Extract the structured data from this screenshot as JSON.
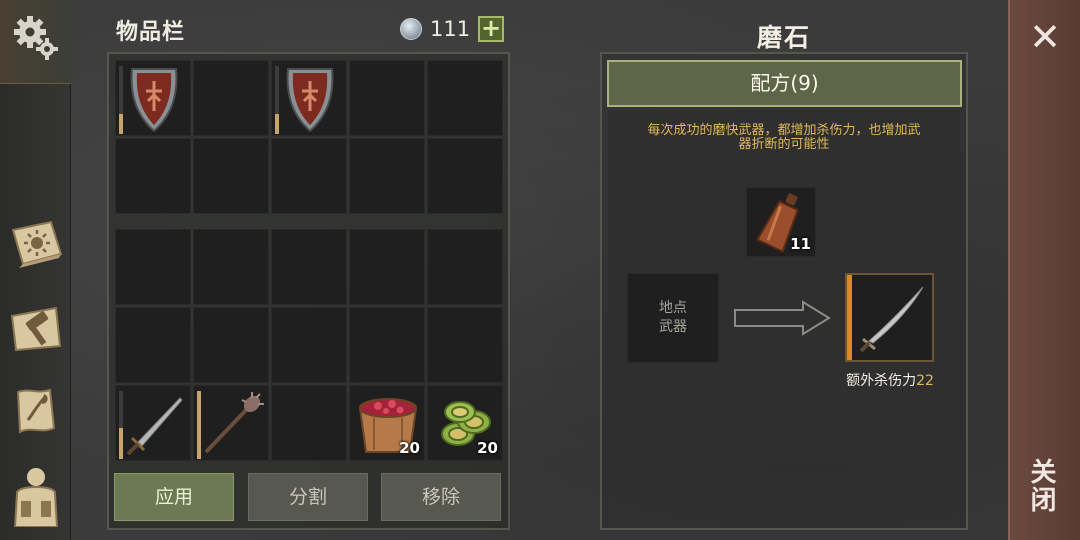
{
  "sidebar": {
    "items": [
      {
        "icon": "gear-icon"
      },
      {
        "icon": "sun-book-icon"
      },
      {
        "icon": "crafting-hammer-icon"
      },
      {
        "icon": "quest-scroll-icon"
      },
      {
        "icon": "character-backpack-icon"
      }
    ]
  },
  "inventory": {
    "title": "物品栏",
    "currency_count": "111",
    "add_label": "+",
    "top_slots": [
      {
        "item": "shield",
        "durability": 0.3
      },
      null,
      {
        "item": "shield",
        "durability": 0.3
      },
      null,
      null,
      null,
      null,
      null,
      null,
      null
    ],
    "bottom_slots": [
      null,
      null,
      null,
      null,
      null,
      null,
      null,
      null,
      null,
      null,
      {
        "item": "sword",
        "durability": 0.45
      },
      {
        "item": "spiked-mace",
        "durability": 1.0
      },
      null,
      {
        "item": "berry-bucket",
        "qty": "20"
      },
      {
        "item": "cucumber-slices",
        "qty": "20"
      }
    ],
    "buttons": {
      "apply": "应用",
      "split": "分割",
      "remove": "移除"
    }
  },
  "craft": {
    "title": "磨石",
    "recipe_tab": "配方(9)",
    "description_line1": "每次成功的磨快武器，都增加杀伤力，也增加武",
    "description_line2": "器折断的可能性",
    "ingredient_qty": "11",
    "input_line1": "地点",
    "input_line2": "武器",
    "output_label": "额外杀伤力",
    "output_value": "22"
  },
  "close": {
    "label": "关闭"
  },
  "colors": {
    "accent_gold": "#e3b85a",
    "recipe_green": "#5d6648",
    "close_red": "#6b4a40"
  }
}
